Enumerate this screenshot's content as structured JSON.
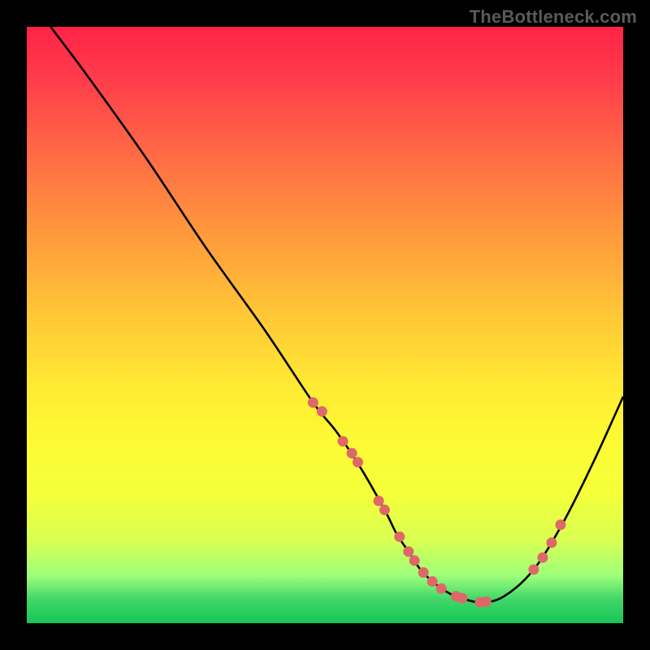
{
  "watermark": "TheBottleneck.com",
  "chart_data": {
    "type": "line",
    "title": "",
    "xlabel": "",
    "ylabel": "",
    "xlim": [
      0,
      100
    ],
    "ylim": [
      0,
      100
    ],
    "series": [
      {
        "name": "curve",
        "x": [
          4,
          10,
          20,
          30,
          40,
          48,
          52,
          56,
          60,
          62,
          64,
          66,
          68,
          70,
          72,
          76,
          80,
          85,
          90,
          95,
          100
        ],
        "y": [
          100,
          92,
          78,
          63,
          49,
          37,
          32,
          26,
          19,
          15,
          12,
          9,
          7,
          5.5,
          4.5,
          3.5,
          4.5,
          9,
          17,
          27,
          38
        ]
      }
    ],
    "markers": {
      "name": "dots",
      "color": "#de6868",
      "x": [
        48,
        49.5,
        53,
        54.5,
        55.5,
        59,
        60,
        62.5,
        64,
        65,
        66.5,
        68,
        69.5,
        72,
        73,
        76,
        77,
        85,
        86.5,
        88,
        89.5
      ],
      "y": [
        37,
        35.5,
        30.5,
        28.5,
        27,
        20.5,
        19,
        14.5,
        12,
        10.5,
        8.5,
        7,
        5.8,
        4.5,
        4.2,
        3.5,
        3.6,
        9,
        11,
        13.5,
        16.5
      ]
    }
  }
}
